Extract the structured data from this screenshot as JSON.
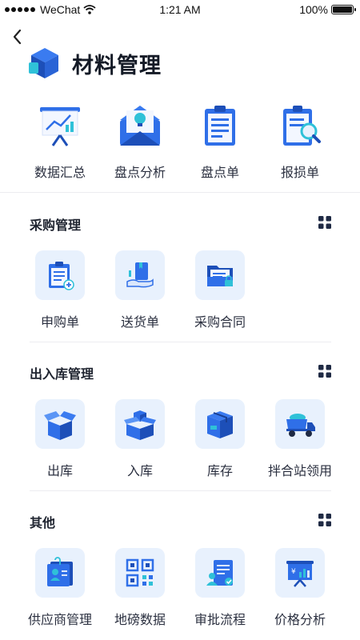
{
  "status": {
    "carrier": "WeChat",
    "time": "1:21 AM",
    "battery": "100%",
    "battery_level": 1.0
  },
  "header": {
    "title": "材料管理",
    "icon": "cube-logo-icon"
  },
  "top_tools": [
    {
      "label": "数据汇总",
      "icon": "presentation-chart-icon"
    },
    {
      "label": "盘点分析",
      "icon": "envelope-lightbulb-icon"
    },
    {
      "label": "盘点单",
      "icon": "clipboard-icon"
    },
    {
      "label": "报损单",
      "icon": "report-search-icon"
    }
  ],
  "sections": [
    {
      "title": "采购管理",
      "items": [
        {
          "label": "申购单",
          "icon": "request-form-icon"
        },
        {
          "label": "送货单",
          "icon": "delivery-hand-icon"
        },
        {
          "label": "采购合同",
          "icon": "contract-folder-icon"
        }
      ]
    },
    {
      "title": "出入库管理",
      "items": [
        {
          "label": "出库",
          "icon": "open-box-icon"
        },
        {
          "label": "入库",
          "icon": "stack-boxes-icon"
        },
        {
          "label": "库存",
          "icon": "inventory-box-icon"
        },
        {
          "label": "拌合站领用",
          "icon": "truck-icon"
        }
      ]
    },
    {
      "title": "其他",
      "items": [
        {
          "label": "供应商管理",
          "icon": "supplier-card-icon"
        },
        {
          "label": "地磅数据",
          "icon": "qr-scale-icon"
        },
        {
          "label": "审批流程",
          "icon": "approval-doc-icon"
        },
        {
          "label": "价格分析",
          "icon": "price-chart-icon"
        }
      ]
    }
  ],
  "colors": {
    "primary": "#2f6fe8",
    "dark_blue": "#1d4fb8",
    "tile_bg": "#e8f1fd",
    "accent_cyan": "#2fc1d8",
    "text": "#1f2430"
  }
}
